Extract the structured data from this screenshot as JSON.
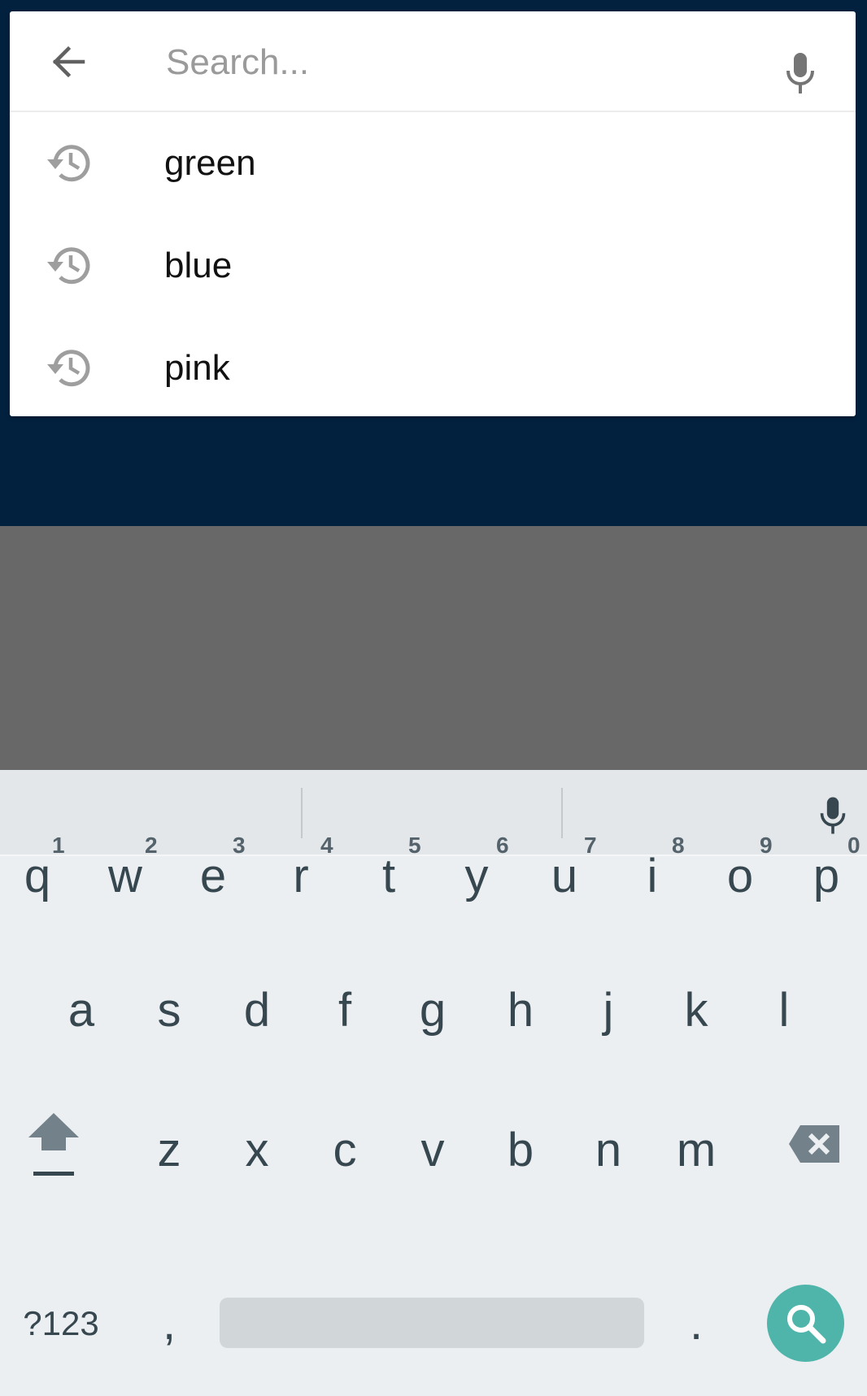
{
  "search": {
    "placeholder": "Search...",
    "value": ""
  },
  "suggestions": [
    {
      "label": "green",
      "icon": "history-icon"
    },
    {
      "label": "blue",
      "icon": "history-icon"
    },
    {
      "label": "pink",
      "icon": "history-icon"
    }
  ],
  "keyboard": {
    "row1": [
      {
        "char": "q",
        "hint": "1"
      },
      {
        "char": "w",
        "hint": "2"
      },
      {
        "char": "e",
        "hint": "3"
      },
      {
        "char": "r",
        "hint": "4"
      },
      {
        "char": "t",
        "hint": "5"
      },
      {
        "char": "y",
        "hint": "6"
      },
      {
        "char": "u",
        "hint": "7"
      },
      {
        "char": "i",
        "hint": "8"
      },
      {
        "char": "o",
        "hint": "9"
      },
      {
        "char": "p",
        "hint": "0"
      }
    ],
    "row2": [
      "a",
      "s",
      "d",
      "f",
      "g",
      "h",
      "j",
      "k",
      "l"
    ],
    "row3": [
      "z",
      "x",
      "c",
      "v",
      "b",
      "n",
      "m"
    ],
    "symbols_label": "?123",
    "comma": ",",
    "period": "."
  },
  "colors": {
    "app_background": "#02213f",
    "scrim": "#686868",
    "keyboard_background": "#eceff1",
    "key_text": "#37474f",
    "search_action": "#4fb5aa"
  },
  "icons": {
    "back": "arrow-back-icon",
    "voice": "microphone-icon",
    "history": "history-icon",
    "shift": "shift-icon",
    "delete": "backspace-icon",
    "search": "search-icon"
  }
}
